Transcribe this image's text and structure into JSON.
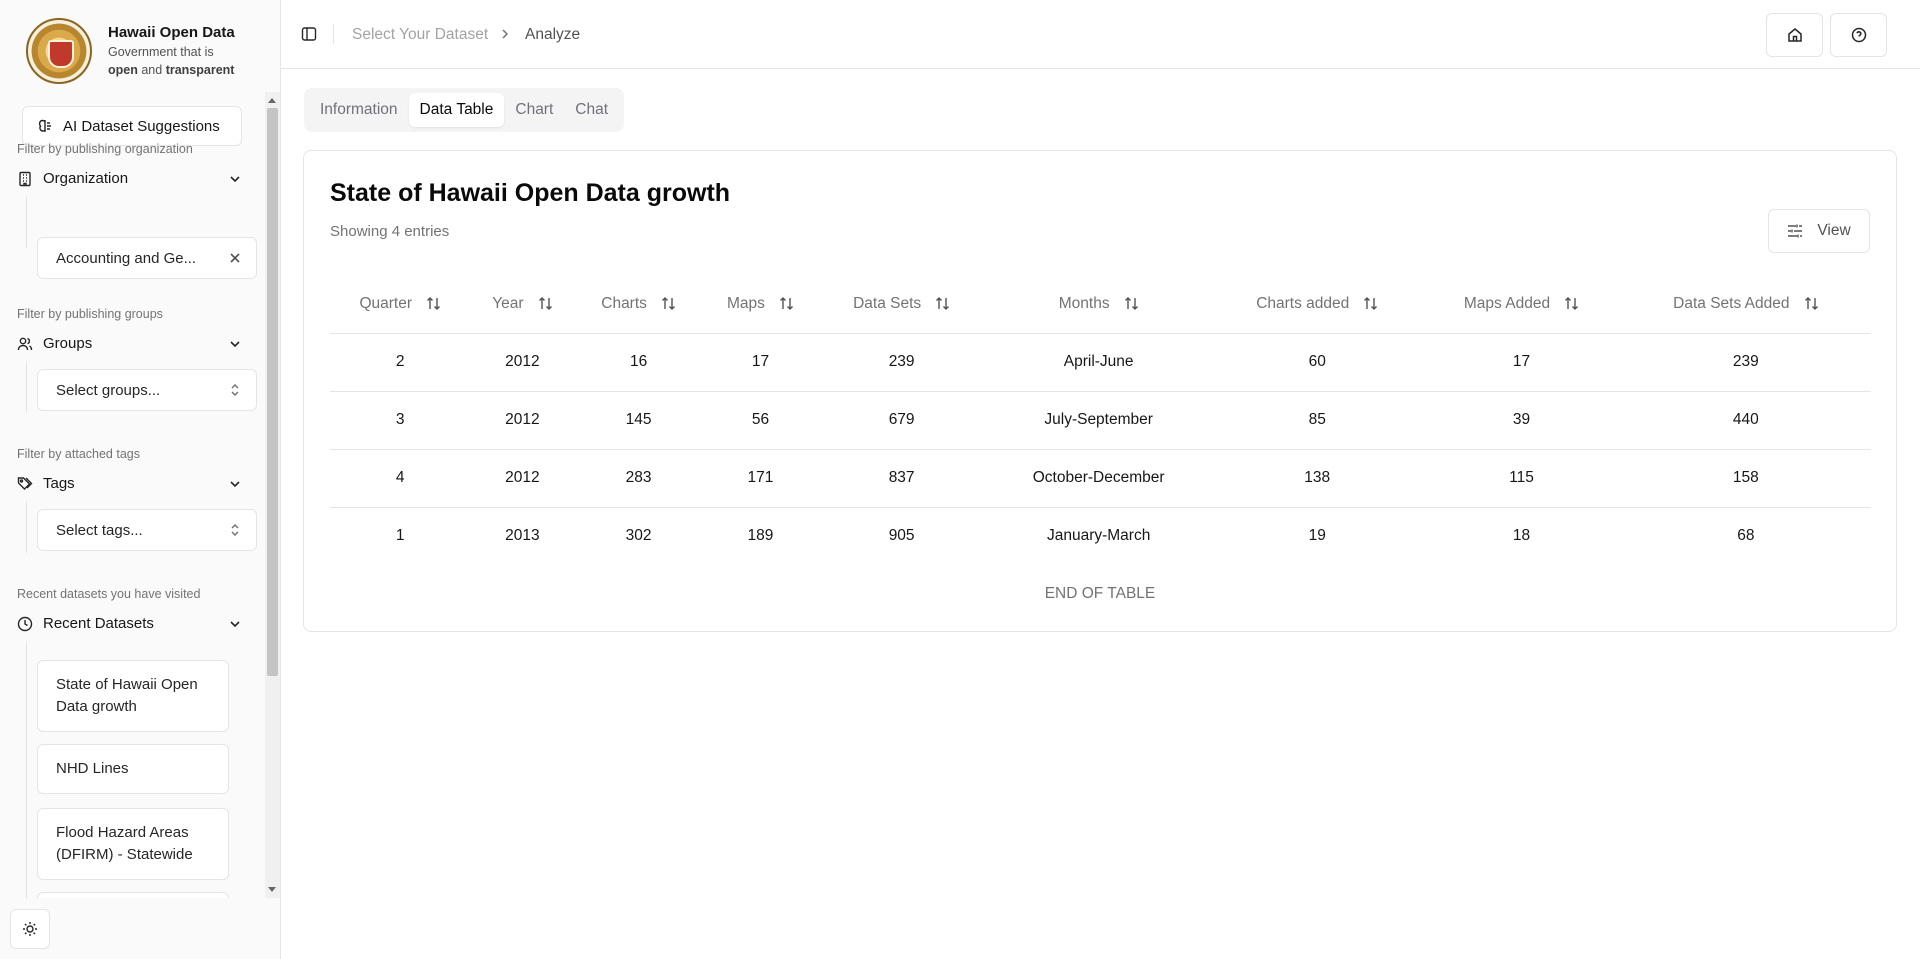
{
  "brand": {
    "title": "Hawaii Open Data",
    "sub_line1": "Government that is",
    "sub_open": "open",
    "sub_and": "and",
    "sub_transparent": "transparent",
    "logo_text": "STATE OF HAWAII"
  },
  "sidebar": {
    "ai_button": "AI Dataset Suggestions",
    "org_hint": "Filter by publishing organization",
    "org_label": "Organization",
    "org_value": "Accounting and Ge...",
    "groups_hint": "Filter by publishing groups",
    "groups_label": "Groups",
    "groups_placeholder": "Select groups...",
    "tags_hint": "Filter by attached tags",
    "tags_label": "Tags",
    "tags_placeholder": "Select tags...",
    "recent_hint": "Recent datasets you have visited",
    "recent_label": "Recent Datasets",
    "recent_items": [
      "State of Hawaii Open Data growth",
      "NHD Lines",
      "Flood Hazard Areas (DFIRM) - Statewide"
    ]
  },
  "header": {
    "crumb1": "Select Your Dataset",
    "crumb2": "Analyze"
  },
  "tabs": [
    "Information",
    "Data Table",
    "Chart",
    "Chat"
  ],
  "active_tab": "Data Table",
  "table_card": {
    "title": "State of Hawaii Open Data growth",
    "subtitle": "Showing 4 entries",
    "view_button": "View",
    "columns": [
      "Quarter",
      "Year",
      "Charts",
      "Maps",
      "Data Sets",
      "Months",
      "Charts added",
      "Maps Added",
      "Data Sets Added"
    ],
    "rows": [
      [
        "2",
        "2012",
        "16",
        "17",
        "239",
        "April-June",
        "60",
        "17",
        "239"
      ],
      [
        "3",
        "2012",
        "145",
        "56",
        "679",
        "July-September",
        "85",
        "39",
        "440"
      ],
      [
        "4",
        "2012",
        "283",
        "171",
        "837",
        "October-December",
        "138",
        "115",
        "158"
      ],
      [
        "1",
        "2013",
        "302",
        "189",
        "905",
        "January-March",
        "19",
        "18",
        "68"
      ]
    ],
    "end_text": "END OF TABLE"
  }
}
